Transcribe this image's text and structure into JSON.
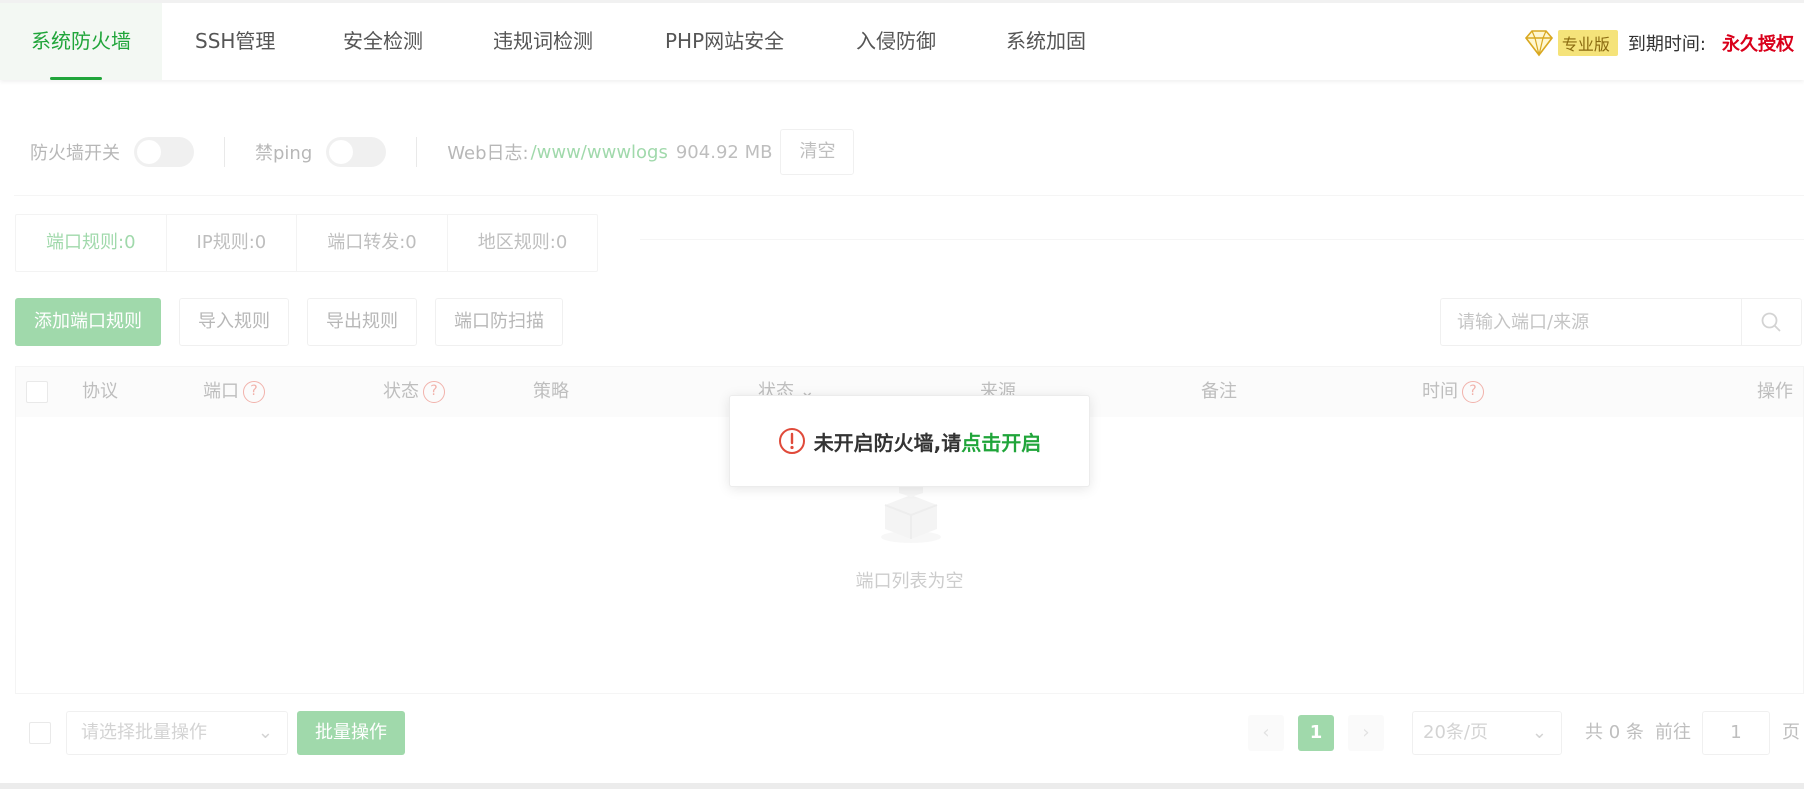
{
  "tabs": [
    {
      "label": "系统防火墙"
    },
    {
      "label": "SSH管理"
    },
    {
      "label": "安全检测"
    },
    {
      "label": "违规词检测"
    },
    {
      "label": "PHP网站安全"
    },
    {
      "label": "入侵防御"
    },
    {
      "label": "系统加固"
    }
  ],
  "header": {
    "edition": "专业版",
    "expire_label": "到期时间:",
    "expire_value": "永久授权"
  },
  "switches": {
    "firewall_label": "防火墙开关",
    "ping_label": "禁ping",
    "weblog_label": "Web日志:",
    "weblog_path": "/www/wwwlogs",
    "weblog_size": "904.92 MB",
    "clear_label": "清空"
  },
  "subtabs": [
    {
      "label": "端口规则:0"
    },
    {
      "label": "IP规则:0"
    },
    {
      "label": "端口转发:0"
    },
    {
      "label": "地区规则:0"
    }
  ],
  "actions": {
    "add": "添加端口规则",
    "import": "导入规则",
    "export": "导出规则",
    "antiscan": "端口防扫描"
  },
  "search": {
    "placeholder": "请输入端口/来源"
  },
  "table": {
    "headers": {
      "protocol": "协议",
      "port": "端口",
      "status": "状态",
      "policy": "策略",
      "state": "状态",
      "source": "来源",
      "remark": "备注",
      "time": "时间",
      "ops": "操作"
    },
    "empty": "端口列表为空"
  },
  "footer": {
    "batch_placeholder": "请选择批量操作",
    "batch_button": "批量操作",
    "page": "1",
    "page_size": "20条/页",
    "total": "共 0 条",
    "goto": "前往",
    "goto_value": "1",
    "page_suffix": "页"
  },
  "toast": {
    "text": "未开启防火墙,请",
    "link": "点击开启"
  },
  "colors": {
    "accent": "#20a53a",
    "danger": "#d9001b",
    "warn": "#e04a3a"
  }
}
